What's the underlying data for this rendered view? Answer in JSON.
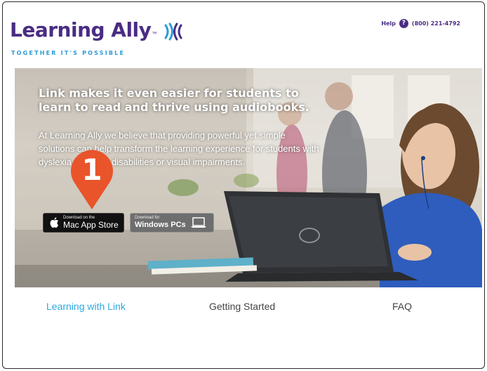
{
  "logo": {
    "brand": "Learning Ally",
    "trademark": "™",
    "tagline": "TOGETHER IT'S POSSIBLE",
    "colors": {
      "brand": "#4a2c83",
      "tagline": "#2e9bd6"
    }
  },
  "help": {
    "label": "Help",
    "icon_glyph": "?",
    "phone": "(800) 221-4792"
  },
  "hero": {
    "heading": "Link makes it even easier for students to learn to read and thrive using audiobooks.",
    "body": "At Learning Ally we believe that providing powerful yet simple solutions can help transform the learning experience for students with dyslexia, learning disabilities or visual impairments.",
    "step_badge": "1",
    "badge_color": "#e9542a",
    "mac_button": {
      "small": "Download on the",
      "big": "Mac App Store",
      "icon": "apple-icon"
    },
    "windows_button": {
      "small": "Download for",
      "big": "Windows PCs",
      "icon": "laptop-icon"
    }
  },
  "nav": {
    "items": [
      {
        "label": "Learning with Link",
        "active": true
      },
      {
        "label": "Getting Started",
        "active": false
      },
      {
        "label": "FAQ",
        "active": false
      }
    ],
    "active_color": "#2ea8e0"
  }
}
